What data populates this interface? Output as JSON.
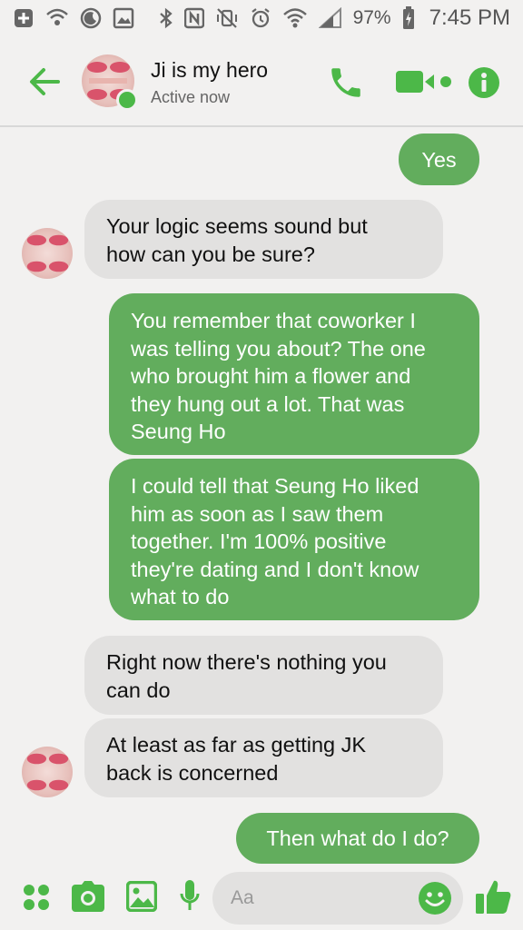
{
  "status_bar": {
    "battery": "97%",
    "time": "7:45 PM"
  },
  "header": {
    "contact_name": "Ji is my hero",
    "contact_status": "Active now"
  },
  "messages": [
    {
      "direction": "outgoing",
      "text": "Yes"
    },
    {
      "direction": "incoming",
      "lines": [
        "Your logic seems sound but",
        "how can you be sure?"
      ]
    },
    {
      "direction": "outgoing",
      "lines": [
        "You remember that coworker I",
        "was telling you about? The one",
        "who brought him a flower and",
        "they hung out a lot. That was",
        "Seung Ho"
      ]
    },
    {
      "direction": "outgoing",
      "lines": [
        "I could tell that Seung Ho liked",
        "him as soon as I saw them",
        "together. I'm 100% positive",
        "they're dating and I don't know",
        "what to do"
      ]
    },
    {
      "direction": "incoming",
      "lines": [
        "Right now there's nothing you",
        "can do"
      ]
    },
    {
      "direction": "incoming",
      "lines": [
        "At least as far as getting JK",
        "back is concerned"
      ]
    },
    {
      "direction": "outgoing",
      "text": "Then what do I do?"
    }
  ],
  "composer": {
    "placeholder": "Aa"
  },
  "colors": {
    "accent": "#4cb848",
    "outgoing_bubble": "#62ad5d",
    "incoming_bubble": "#e2e1e0",
    "background": "#f2f1f0"
  }
}
